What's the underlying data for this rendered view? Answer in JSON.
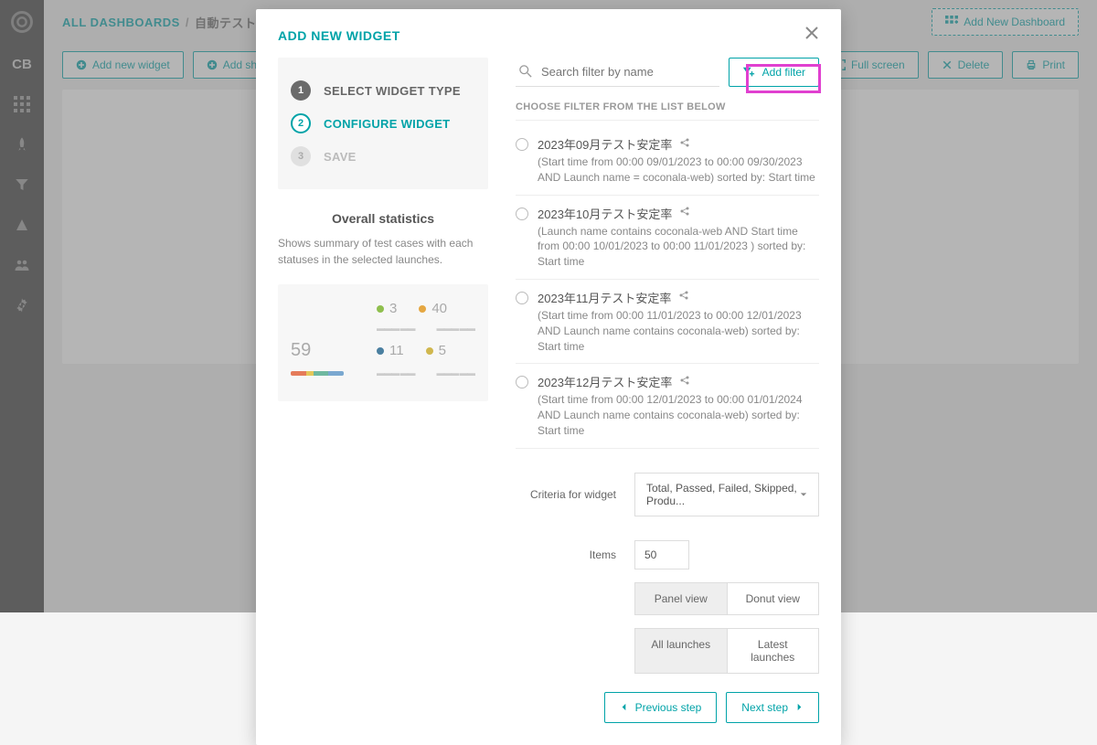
{
  "sidebar": {
    "project": "CB"
  },
  "breadcrumb": {
    "root": "ALL DASHBOARDS",
    "current": "自動テストモ"
  },
  "header": {
    "add_dashboard": "Add New Dashboard"
  },
  "toolbar": {
    "add_widget": "Add new widget",
    "add_share": "Add share",
    "full_screen": "Full screen",
    "delete": "Delete",
    "print": "Print"
  },
  "modal": {
    "title": "ADD NEW WIDGET",
    "steps": [
      {
        "num": "1",
        "label": "SELECT WIDGET TYPE",
        "state": "done"
      },
      {
        "num": "2",
        "label": "CONFIGURE WIDGET",
        "state": "active"
      },
      {
        "num": "3",
        "label": "SAVE",
        "state": "pending"
      }
    ],
    "preview": {
      "title": "Overall statistics",
      "desc": "Shows summary of test cases with each statuses in the selected launches.",
      "big": "59",
      "cells": [
        {
          "num": "3",
          "color": "#8fbf4e"
        },
        {
          "num": "40",
          "color": "#e5a742"
        },
        {
          "num": "11",
          "color": "#4a7fa0"
        },
        {
          "num": "5",
          "color": "#d0b74e"
        }
      ]
    },
    "search_placeholder": "Search filter by name",
    "add_filter": "Add filter",
    "section_label": "CHOOSE FILTER FROM THE LIST BELOW",
    "filters": [
      {
        "name": "2023年09月テスト安定率",
        "desc": "(Start time from 00:00 09/01/2023 to 00:00 09/30/2023 AND Launch name = coconala-web) sorted by: Start time"
      },
      {
        "name": "2023年10月テスト安定率",
        "desc": "(Launch name contains coconala-web AND Start time from 00:00 10/01/2023 to 00:00 11/01/2023 ) sorted by: Start time"
      },
      {
        "name": "2023年11月テスト安定率",
        "desc": "(Start time from 00:00 11/01/2023 to 00:00 12/01/2023 AND Launch name contains coconala-web) sorted by: Start time"
      },
      {
        "name": "2023年12月テスト安定率",
        "desc": "(Start time from 00:00 12/01/2023 to 00:00 01/01/2024 AND Launch name contains coconala-web) sorted by: Start time"
      }
    ],
    "criteria_label": "Criteria for widget",
    "criteria_value": "Total, Passed, Failed, Skipped, Produ...",
    "items_label": "Items",
    "items_value": "50",
    "view_toggle": {
      "panel": "Panel view",
      "donut": "Donut view"
    },
    "launch_toggle": {
      "all": "All launches",
      "latest": "Latest launches"
    },
    "prev": "Previous step",
    "next": "Next step"
  }
}
